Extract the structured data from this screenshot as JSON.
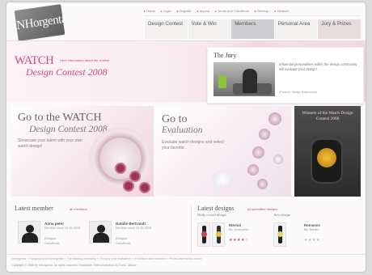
{
  "header": {
    "logo_text": "INHorgenta",
    "utility_nav": [
      "Home",
      "Login",
      "Register",
      "Imprint",
      "Terms and Conditions",
      "Sitemap",
      "Deutsch"
    ],
    "main_nav": [
      {
        "label": "Design Contest"
      },
      {
        "label": "Vote & Win"
      },
      {
        "label": "Members"
      },
      {
        "label": "Personal Area"
      },
      {
        "label": "Jury & Prizes"
      }
    ]
  },
  "hero": {
    "title": "WATCH",
    "link": "Here information about the contest",
    "subtitle": "Design Contest 2008"
  },
  "jury": {
    "title": "The Jury",
    "text": "Influential personalities within the design community will evaluate your design!",
    "caption": "(Picture: Nadja Swarovski)"
  },
  "tiles": [
    {
      "heading": "Go to the WATCH",
      "subheading": "Design Contest 2008",
      "text": "Showcase your talent with your own watch design!"
    },
    {
      "heading": "Go to",
      "subheading": "Evaluation",
      "text": "Evaluate watch designs and select your favorite."
    },
    {
      "text": "Winners of the Watch Design Contest 2008"
    }
  ],
  "latest_member": {
    "title": "Latest member",
    "link": "all members",
    "members": [
      {
        "name": "Anna peter",
        "meta": "Member since 24.10.2008",
        "links": [
          "Designs",
          "Guestbook"
        ]
      },
      {
        "name": "Natalie Bertrandt",
        "meta": "Member since 24.10.2008",
        "links": [
          "Designs",
          "Guestbook"
        ]
      }
    ]
  },
  "latest_designs": {
    "title": "Latest designs",
    "link": "all submitted designs",
    "categories": [
      "Daily crowd design",
      "Jury design"
    ],
    "designs": [
      {
        "name": "Eternal",
        "meta": "By: Anna peter",
        "stars": "★★★★☆"
      },
      {
        "name": "Romance",
        "meta": "By: Natalie",
        "stars": "★★★★☆"
      }
    ]
  },
  "footer": {
    "links": "Inhorgenta  »  Fairground of Inhorgenta  »  The leading company  »  The jury and evaluation  »  Exhibitors and partners  »  Press and media center",
    "copyright": "Copyright © 2008 by Inhorgenta. All rights reserved. Disclaimer. Web production by Forsk. Messe"
  },
  "colors": {
    "accent": "#d1477d",
    "nav_active": "#cfcfd3"
  }
}
